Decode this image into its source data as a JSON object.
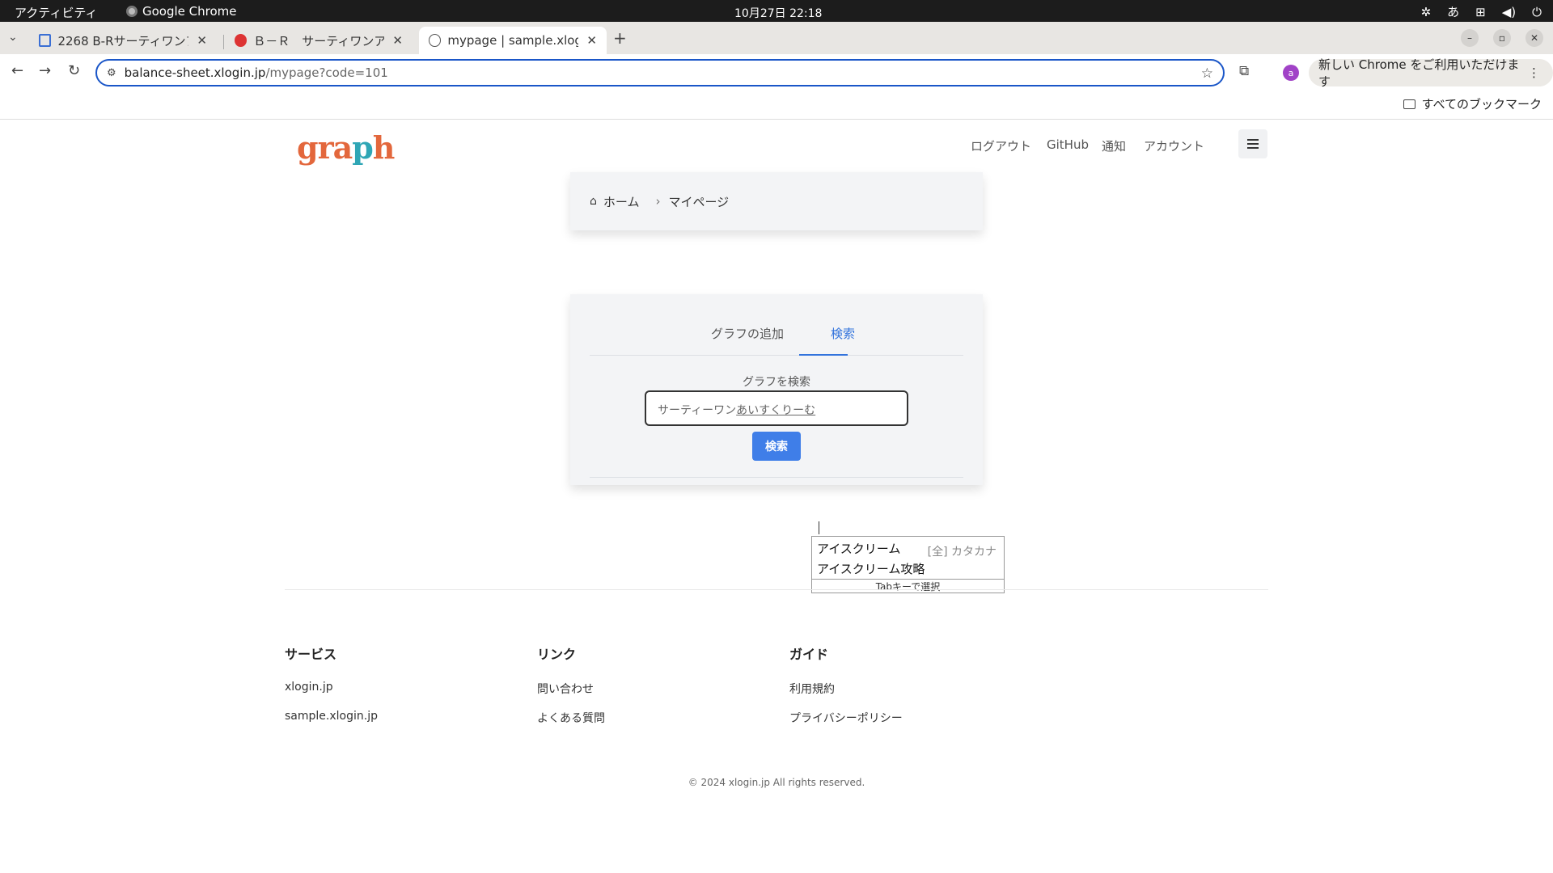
{
  "system_bar": {
    "activities": "アクティビティ",
    "app_name": "Google Chrome",
    "clock": "10月27日  22:18",
    "ime_indicator": "あ"
  },
  "browser": {
    "tabs": [
      {
        "label": "2268 B-Rサーティワンア",
        "icon": "chart-favicon-icon",
        "active": false
      },
      {
        "label": "Ｂ－Ｒ　サーティワンア",
        "icon": "br-favicon-icon",
        "active": false
      },
      {
        "label": "mypage | sample.xlogin.j",
        "icon": "globe-favicon-icon",
        "active": true
      }
    ],
    "url_host": "balance-sheet.xlogin.jp",
    "url_path": "/mypage?code=101",
    "profile_initial": "a",
    "update_chip": "新しい Chrome をご利用いただけます",
    "all_bookmarks": "すべてのブックマーク"
  },
  "site": {
    "logo": {
      "part1": "gra",
      "part2": "p",
      "part3": "h"
    },
    "nav": [
      "ログアウト",
      "GitHub",
      "通知",
      "アカウント"
    ],
    "breadcrumb": {
      "home": "ホーム",
      "current": "マイページ"
    },
    "tabs": {
      "add": "グラフの追加",
      "search": "検索"
    },
    "search_label": "グラフを検索",
    "search_value_plain": "サーティーワン",
    "search_value_ime": "あいすくりーむ",
    "search_button": "検索",
    "ime_popup": {
      "candidate1": "アイスクリーム",
      "candidate1_type": "[全] カタカナ",
      "candidate2": "アイスクリーム攻略",
      "footer": "Tabキーで選択"
    },
    "footer": {
      "services": {
        "title": "サービス",
        "links": [
          "xlogin.jp",
          "sample.xlogin.jp"
        ]
      },
      "links": {
        "title": "リンク",
        "links": [
          "問い合わせ",
          "よくある質問"
        ]
      },
      "guide": {
        "title": "ガイド",
        "links": [
          "利用規約",
          "プライバシーポリシー"
        ]
      },
      "copyright": "© 2024 xlogin.jp All rights reserved."
    }
  },
  "colors": {
    "accent": "#3273dc",
    "button": "#3f7ee8",
    "logo": "#e3673c",
    "logo_accent": "#2fa6b5"
  }
}
